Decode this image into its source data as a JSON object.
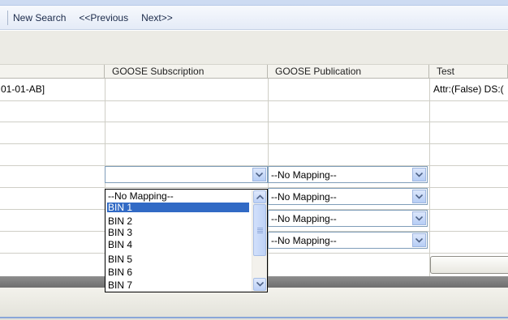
{
  "toolbar": {
    "new_search": "New Search",
    "previous": "<<Previous",
    "next": "Next>>"
  },
  "grid": {
    "columns": [
      "GOOSE Subscription",
      "GOOSE Publication",
      "Test"
    ],
    "rows": [
      {
        "id": "01-01-AB]",
        "test": "Attr:(False) DS:("
      }
    ],
    "publication_dropdowns": [
      "--No Mapping--",
      "--No Mapping--",
      "--No Mapping--",
      "--No Mapping--"
    ],
    "subscription_dropdown_value": ""
  },
  "dropdown": {
    "options": [
      "--No Mapping--",
      "BIN 1",
      "BIN 2",
      "BIN 3",
      "BIN 4",
      "BIN 5",
      "BIN 6",
      "BIN 7"
    ],
    "selected": "BIN 1"
  },
  "colors": {
    "selection": "#316ac5",
    "combo_border": "#7f9db9",
    "accent_line": "#8aa6d8"
  }
}
